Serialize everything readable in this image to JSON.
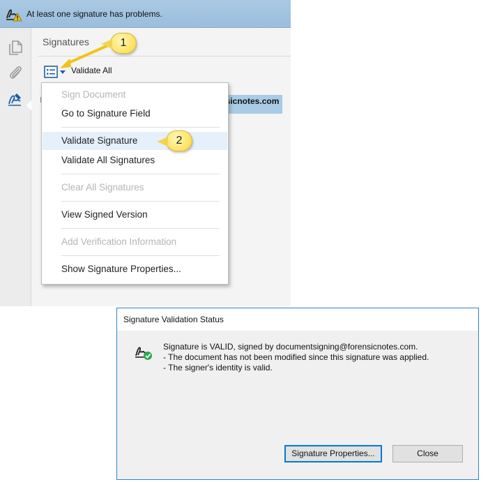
{
  "notification": {
    "message": "At least one signature has problems."
  },
  "panel": {
    "title": "Signatures",
    "validate_all_label": "Validate All",
    "signature_row_fragment": "rsicnotes.com"
  },
  "menu": {
    "items": [
      {
        "label": "Sign Document",
        "enabled": false
      },
      {
        "label": "Go to Signature Field",
        "enabled": true
      },
      {
        "label": "Validate Signature",
        "enabled": true,
        "highlighted": true
      },
      {
        "label": "Validate All Signatures",
        "enabled": true
      },
      {
        "label": "Clear All Signatures",
        "enabled": false
      },
      {
        "label": "View Signed Version",
        "enabled": true
      },
      {
        "label": "Add Verification Information",
        "enabled": false
      },
      {
        "label": "Show Signature Properties...",
        "enabled": true
      }
    ]
  },
  "callouts": [
    "1",
    "2"
  ],
  "dialog": {
    "title": "Signature Validation Status",
    "lines": [
      "Signature is VALID, signed by documentsigning@forensicnotes.com.",
      "- The document has not been modified since this signature was applied.",
      "- The signer's identity is valid."
    ],
    "properties_button": "Signature Properties...",
    "close_button": "Close"
  },
  "icons": {
    "notification": "signature-warning-icon",
    "left_tools": [
      "pages-icon",
      "attachment-icon",
      "signature-pen-icon"
    ],
    "options": "options-list-icon",
    "dialog_status": "signature-valid-icon"
  },
  "colors": {
    "topbar": "#9bbedd",
    "menu_highlight": "#e5f0fb",
    "callout": "#ffe56c",
    "dialog_border": "#2f83c9",
    "accent": "#1e5ea8"
  }
}
